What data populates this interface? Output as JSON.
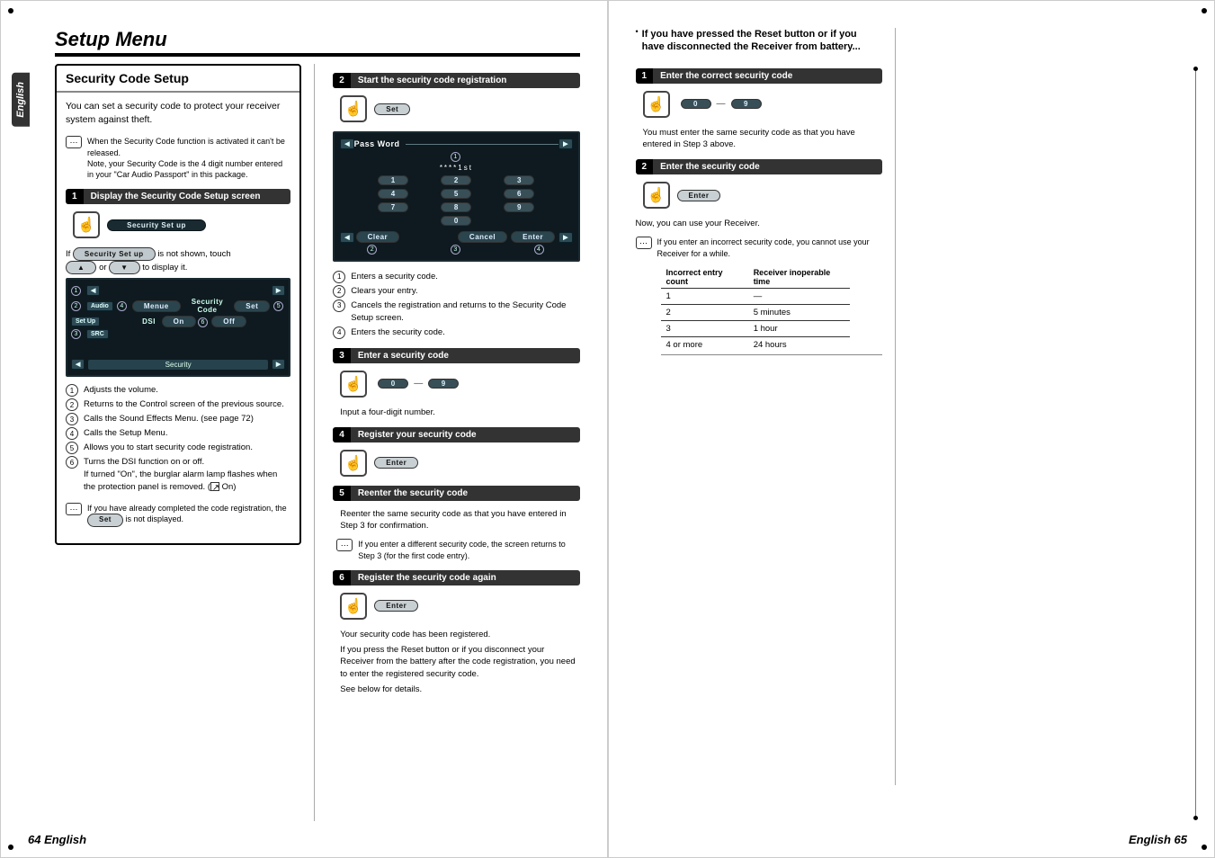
{
  "pageHeader": "Setup Menu",
  "langTab": "English",
  "footerLeft": "64 English",
  "footerRight": "English 65",
  "sectionTitle": "Security Code Setup",
  "intro": "You can set a security code to protect your receiver system against theft.",
  "note1a": "When the Security Code function is activated it can't be released.",
  "note1b": "Note, your Security Code is the 4 digit number entered in your \"Car Audio Passport\" in this package.",
  "step1": {
    "num": "1",
    "text": "Display the Security Code Setup screen"
  },
  "pillSecuritySetup": "Security Set up",
  "ifNotShown1": "If ",
  "ifNotShown2": " is not shown, touch ",
  "ifNotShown3": " or ",
  "ifNotShown4": " to display it.",
  "arrowUp": "▲",
  "arrowDown": "▼",
  "screen1": {
    "menuBtn": "Menue",
    "title": "Security Code",
    "setBtn": "Set",
    "dsiLabel": "DSI",
    "on": "On",
    "off": "Off",
    "securityBar": "Security",
    "sideAudio": "Audio",
    "sideSetup": "Set Up",
    "sideSrc": "SRC"
  },
  "legend1": {
    "i1": "Adjusts the volume.",
    "i2": "Returns to the Control screen of the previous source.",
    "i3": "Calls the Sound Effects Menu. (see page 72)",
    "i4": "Calls the Setup Menu.",
    "i5": "Allows you to start security code registration.",
    "i6a": "Turns the DSI function on or off.",
    "i6b": "If turned \"On\", the burglar alarm lamp flashes when the protection panel is removed. (",
    "i6c": " On)"
  },
  "note2": "If you have already completed the code registration, the ",
  "note2b": " is not displayed.",
  "pillSetSmall": "Set",
  "step2": {
    "num": "2",
    "text": "Start the security code registration"
  },
  "pillSet": "Set",
  "keypad": {
    "title": "Pass Word",
    "masked": "****1st",
    "k1": "1",
    "k2": "2",
    "k3": "3",
    "k4": "4",
    "k5": "5",
    "k6": "6",
    "k7": "7",
    "k8": "8",
    "k9": "9",
    "k0": "0",
    "clear": "Clear",
    "cancel": "Cancel",
    "enter": "Enter"
  },
  "legend2": {
    "i1": "Enters a security code.",
    "i2": "Clears your entry.",
    "i3": "Cancels the registration and returns to the Security Code Setup screen.",
    "i4": "Enters the security code."
  },
  "step3": {
    "num": "3",
    "text": "Enter a security code"
  },
  "digitsNote": "Input a four-digit number.",
  "dig0": "0",
  "dig9": "9",
  "step4": {
    "num": "4",
    "text": "Register your security code"
  },
  "pillEnter": "Enter",
  "step5": {
    "num": "5",
    "text": "Reenter the security code"
  },
  "reenterText": "Reenter the same security code as that you have entered in Step 3 for confirmation.",
  "note3": "If you enter a different security code, the screen returns to Step 3 (for the first code entry).",
  "step6": {
    "num": "6",
    "text": "Register the security code again"
  },
  "afterReg": "Your security code has been registered.",
  "afterReg2": "If you press the Reset button or if you disconnect your Receiver from the battery after the code registration, you need to enter the registered security code.",
  "afterReg3": "See below for details.",
  "rightTitle": "If you have pressed the Reset button or if you have disconnected the Receiver from battery...",
  "rstep1": {
    "num": "1",
    "text": "Enter the correct security code"
  },
  "rMustEnter": "You must enter the same security code as that you have entered in Step 3 above.",
  "rstep2": {
    "num": "2",
    "text": "Enter the security code"
  },
  "nowUse": "Now, you can use your Receiver.",
  "note4": "If you enter an incorrect security code, you cannot use your Receiver for a while.",
  "table": {
    "h1": "Incorrect entry count",
    "h2": "Receiver inoperable time",
    "r1c1": "1",
    "r1c2": "—",
    "r2c1": "2",
    "r2c2": "5 minutes",
    "r3c1": "3",
    "r3c2": "1 hour",
    "r4c1": "4 or more",
    "r4c2": "24 hours"
  }
}
